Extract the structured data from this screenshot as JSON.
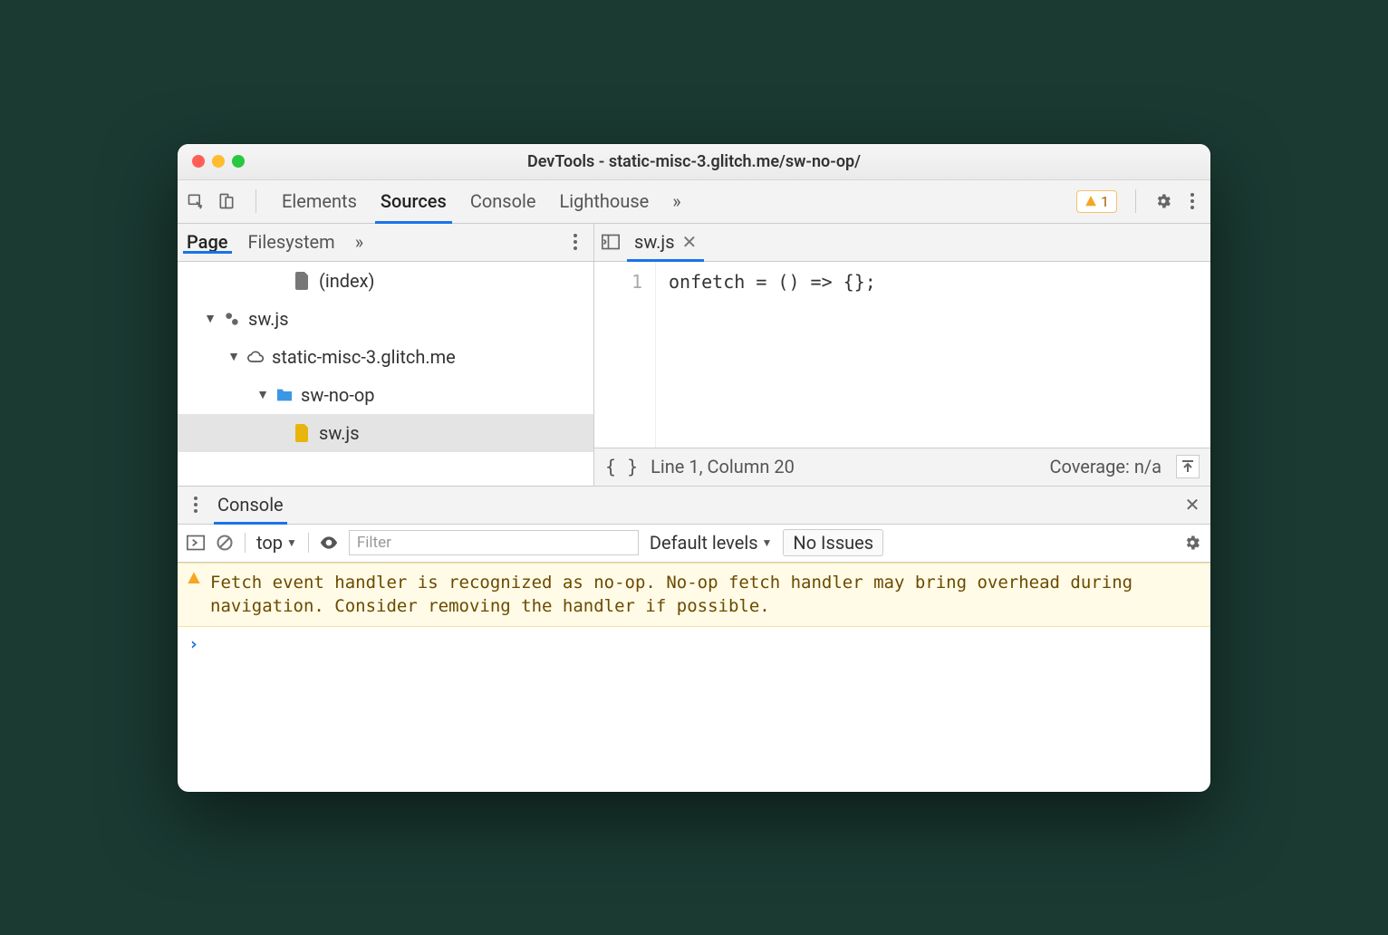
{
  "window": {
    "title": "DevTools - static-misc-3.glitch.me/sw-no-op/"
  },
  "toolbar": {
    "tabs": [
      "Elements",
      "Sources",
      "Console",
      "Lighthouse"
    ],
    "active_tab_index": 1,
    "overflow": "»",
    "warning_count": "1"
  },
  "nav": {
    "tabs": [
      "Page",
      "Filesystem"
    ],
    "active_tab_index": 0,
    "overflow": "»",
    "tree": {
      "index_label": "(index)",
      "sw_worker": "sw.js",
      "domain": "static-misc-3.glitch.me",
      "folder": "sw-no-op",
      "file": "sw.js"
    }
  },
  "editor": {
    "tab_label": "sw.js",
    "line_number": "1",
    "code": "onfetch = () => {};",
    "status_pos": "Line 1, Column 20",
    "coverage": "Coverage: n/a"
  },
  "drawer": {
    "tab_label": "Console",
    "context": "top",
    "filter_placeholder": "Filter",
    "levels": "Default levels",
    "no_issues": "No Issues",
    "warning": "Fetch event handler is recognized as no-op. No-op fetch handler may bring overhead during navigation. Consider removing the handler if possible.",
    "prompt": "›"
  }
}
